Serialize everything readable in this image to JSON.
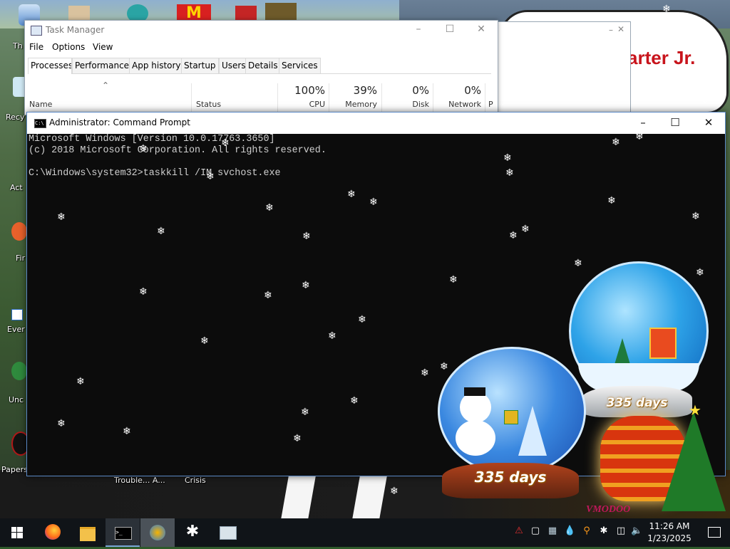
{
  "task_manager": {
    "title": "Task Manager",
    "menu": [
      "File",
      "Options",
      "View"
    ],
    "tabs": [
      "Processes",
      "Performance",
      "App history",
      "Startup",
      "Users",
      "Details",
      "Services"
    ],
    "columns": {
      "name": "Name",
      "status": "Status",
      "cpu": {
        "label": "CPU",
        "value": "100%"
      },
      "memory": {
        "label": "Memory",
        "value": "39%"
      },
      "disk": {
        "label": "Disk",
        "value": "0%"
      },
      "network": {
        "label": "Network",
        "value": "0%"
      },
      "power_abbrev": "P"
    }
  },
  "cmd": {
    "title": "Administrator: Command Prompt",
    "lines": [
      "Microsoft Windows [Version 10.0.17763.3650]",
      "(c) 2018 Microsoft Corporation. All rights reserved.",
      "",
      "C:\\Windows\\system32>taskkill /IM svchost.exe"
    ]
  },
  "wallpaper": {
    "banner_text": "arter Jr.",
    "globe_left_days": "335 days",
    "globe_right_days": "335 days",
    "watermark": "VMODOO"
  },
  "desktop_icons": [
    {
      "label": "Th",
      "icon": "phone-icon"
    },
    {
      "label": "Recy",
      "icon": "recycle-bin-icon"
    },
    {
      "label": "Act",
      "icon": "activate-icon"
    },
    {
      "label": "Fir",
      "icon": "firefox-shortcut-icon"
    },
    {
      "label": "Ever",
      "icon": "everything-shortcut-icon"
    },
    {
      "label": "Unc",
      "icon": "uncle-shortcut-icon"
    },
    {
      "label": "Papers",
      "icon": "papers-icon"
    }
  ],
  "desktop_bottom_labels": [
    "Trouble... A...",
    "Crisis"
  ],
  "taskbar": {
    "apps": [
      "windows-start-icon",
      "firefox-icon",
      "file-explorer-icon",
      "command-prompt-icon",
      "network-app-icon",
      "snowflake-app-icon",
      "monitor-app-icon"
    ],
    "clock_time": "11:26 AM",
    "clock_date": "1/23/2025"
  },
  "colors": {
    "taskbar": "#101418",
    "cmd_bg": "#0c0c0c",
    "cmd_text": "#cfcfcf",
    "accent_blue": "#5a88c5"
  }
}
